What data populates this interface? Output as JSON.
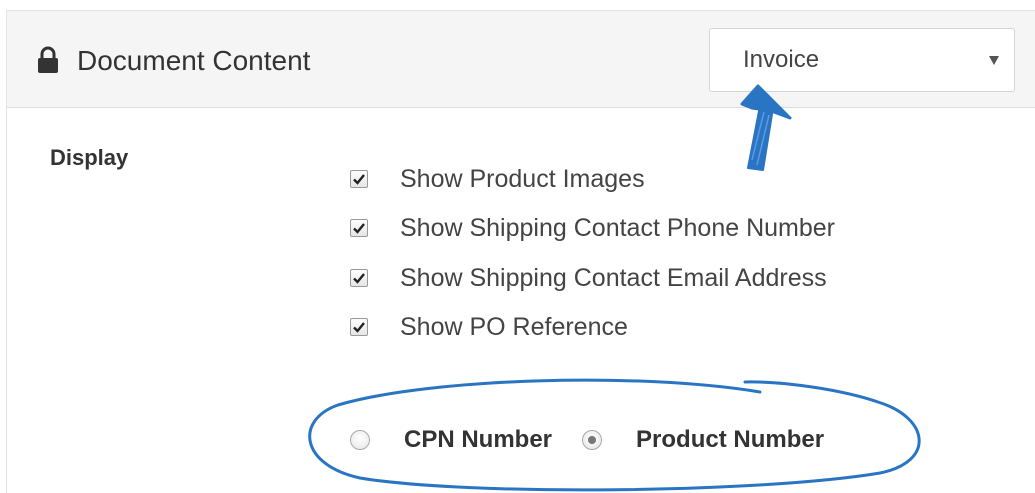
{
  "panel": {
    "title": "Document Content",
    "title_icon": "lock-icon"
  },
  "document_select": {
    "selected": "Invoice",
    "icon": "chevron-down-icon"
  },
  "display": {
    "label": "Display",
    "checkboxes": [
      {
        "label": "Show Product Images",
        "checked": true
      },
      {
        "label": "Show Shipping Contact Phone Number",
        "checked": true
      },
      {
        "label": "Show Shipping Contact Email Address",
        "checked": true
      },
      {
        "label": "Show PO Reference",
        "checked": true
      }
    ],
    "number_type": {
      "options": [
        {
          "label": "CPN Number",
          "selected": false
        },
        {
          "label": "Product Number",
          "selected": true
        }
      ]
    }
  },
  "annotations": {
    "color": "#2a74c4",
    "arrow": "pointing up at the Invoice dropdown",
    "ellipse": "circling the CPN Number / Product Number radio options"
  }
}
